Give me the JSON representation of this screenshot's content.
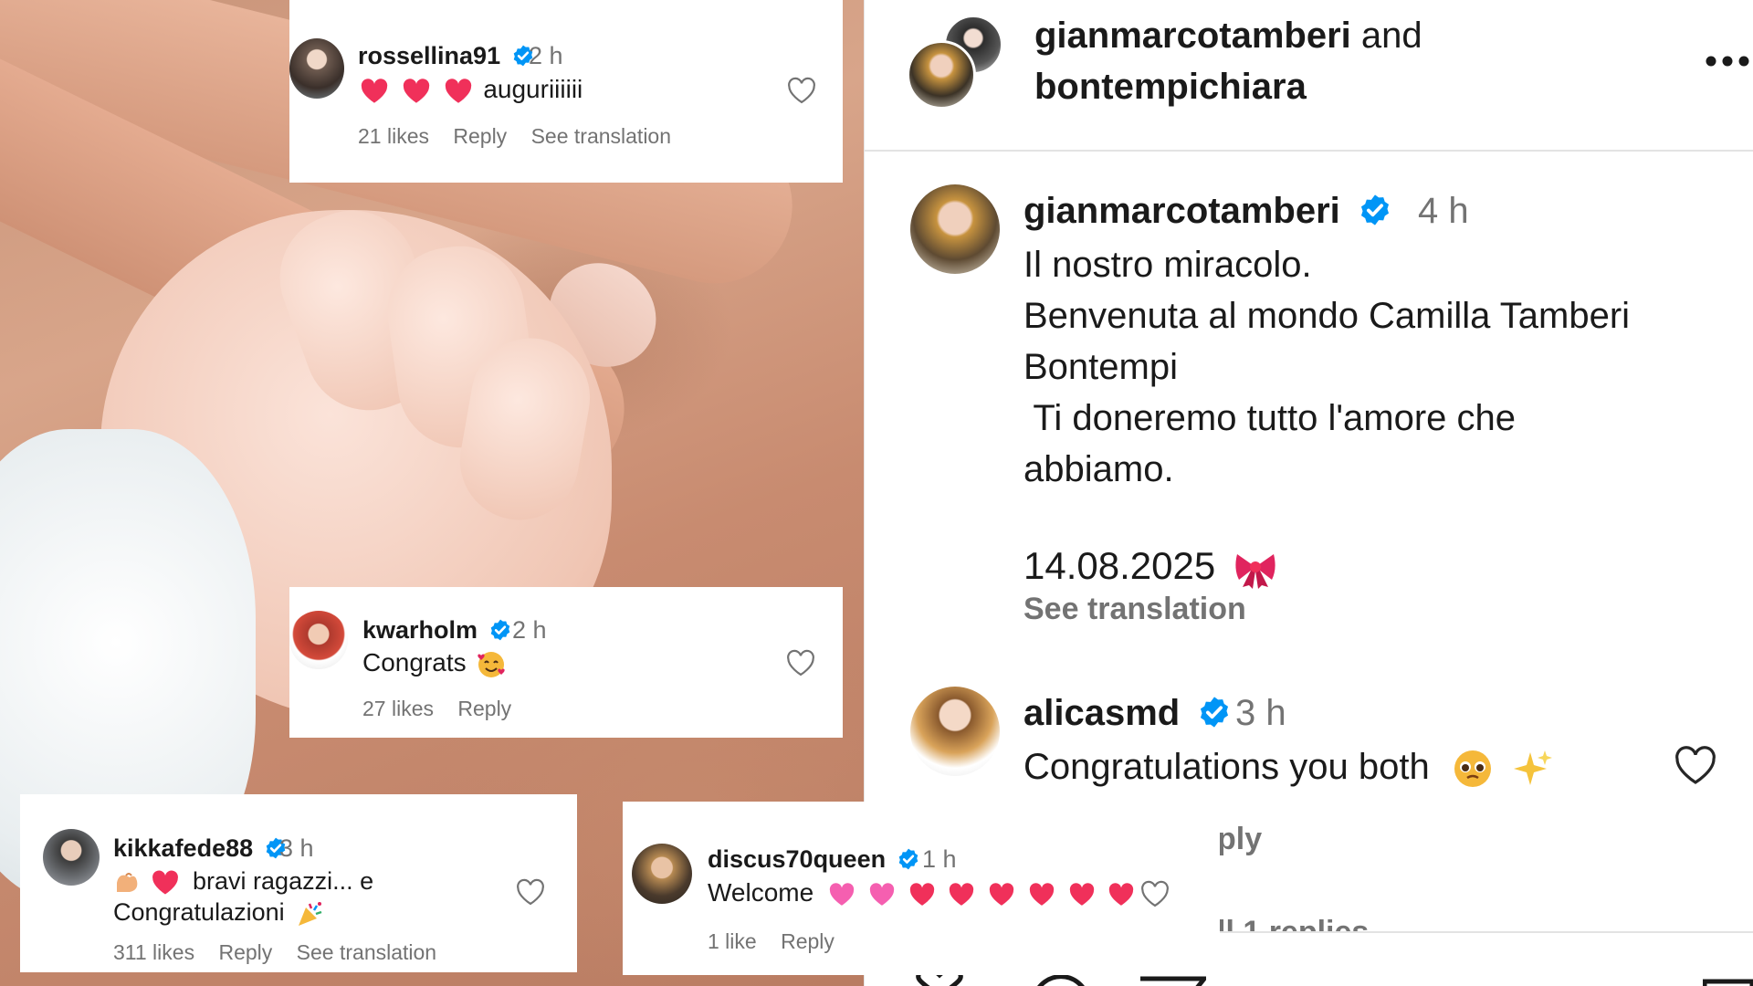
{
  "header": {
    "author1": "gianmarcotamberi",
    "joiner": "and",
    "author2": "bontempichiara",
    "more_icon": "more-dots-icon"
  },
  "post": {
    "username": "gianmarcotamberi",
    "time": "4 h",
    "caption_lines": [
      "Il nostro miracolo.",
      "Benvenuta al mondo Camilla Tamberi",
      "Bontempi",
      " Ti doneremo tutto l'amore che",
      "abbiamo."
    ],
    "date": "14.08.2025",
    "date_emoji": "ribbon-icon",
    "see_translation": "See translation"
  },
  "comments": {
    "alicasmd": {
      "username": "alicasmd",
      "time": "3 h",
      "text": "Congratulations you both",
      "emoji": [
        "pleading-face-icon",
        "sparkles-icon"
      ],
      "reply_partial": "ply",
      "view_replies_partial": "ll 1 replies"
    },
    "rossellina91": {
      "username": "rossellina91",
      "time": "2 h",
      "text": "auguriiiiii",
      "likes": "21 likes",
      "reply": "Reply",
      "see_translation": "See translation"
    },
    "kwarholm": {
      "username": "kwarholm",
      "time": "2 h",
      "text": "Congrats",
      "likes": "27 likes",
      "reply": "Reply"
    },
    "kikkafede88": {
      "username": "kikkafede88",
      "time": "3 h",
      "line1": "bravi ragazzi... e",
      "line2": "Congratulazioni",
      "likes": "311 likes",
      "reply": "Reply",
      "see_translation": "See translation"
    },
    "discus70queen": {
      "username": "discus70queen",
      "time": "1 h",
      "text": "Welcome",
      "likes": "1 like",
      "reply": "Reply"
    }
  },
  "colors": {
    "verified": "#0095f6",
    "heart_red": "#f0305a",
    "meta_gray": "#737373"
  }
}
